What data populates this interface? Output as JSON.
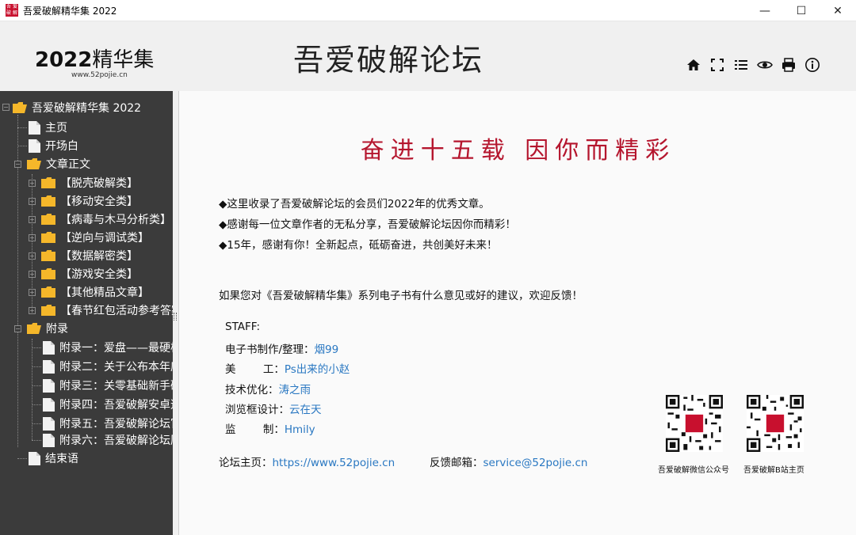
{
  "window": {
    "title": "吾爱破解精华集 2022",
    "app_icon_text": [
      "吾",
      "爱",
      "破",
      "解"
    ],
    "minimize": "—",
    "maximize": "☐",
    "close": "✕"
  },
  "header": {
    "logo_year": "2022",
    "logo_text": "精华集",
    "logo_url": "www.52pojie.cn",
    "site_title": "吾爱破解论坛"
  },
  "toolbar": {
    "buttons": [
      "home-icon",
      "fullscreen-icon",
      "list-icon",
      "eye-icon",
      "print-icon",
      "info-icon"
    ]
  },
  "sidebar": {
    "root": "吾爱破解精华集 2022",
    "home": "主页",
    "intro": "开场白",
    "articles": "文章正文",
    "article_categories": [
      "【脱壳破解类】",
      "【移动安全类】",
      "【病毒与木马分析类】",
      "【逆向与调试类】",
      "【数据解密类】",
      "【游戏安全类】",
      "【其他精品文章】",
      "【春节红包活动参考答案】"
    ],
    "appendix": "附录",
    "appendix_items": [
      "附录一：爱盘——最硬核",
      "附录二：关于公布本年度",
      "附录三：关零基础新手研",
      "附录四：吾爱破解安卓逆",
      "附录五：吾爱破解论坛官",
      "附录六：吾爱破解论坛历"
    ],
    "closing": "结束语"
  },
  "content": {
    "headline": "奋进十五载  因你而精彩",
    "bullets": [
      "◆这里收录了吾爱破解论坛的会员们2022年的优秀文章。",
      "◆感谢每一位文章作者的无私分享，吾爱破解论坛因你而精彩！",
      "◆15年，感谢有你！全新起点，砥砺奋进，共创美好未来！"
    ],
    "feedback_text": "如果您对《吾爱破解精华集》系列电子书有什么意见或好的建议，欢迎反馈！",
    "staff_heading": "STAFF:",
    "staff": [
      {
        "role": "电子书制作/整理：",
        "name": "烟99"
      },
      {
        "role": "美        工：",
        "name": "Ps出来的小赵"
      },
      {
        "role": "技术优化：",
        "name": "涛之雨"
      },
      {
        "role": "浏览框设计：",
        "name": "云在天"
      },
      {
        "role": "监        制：",
        "name": "Hmily"
      }
    ],
    "forum_label": "论坛主页：",
    "forum_url": "https://www.52pojie.cn",
    "email_label": "反馈邮箱：",
    "email": "service@52pojie.cn",
    "qr_codes": [
      {
        "caption": "吾爱破解微信公众号",
        "badge": "吾爱破解"
      },
      {
        "caption": "吾爱破解B站主页",
        "badge": "吾爱破解"
      }
    ]
  },
  "colors": {
    "accent_red": "#b5162e",
    "link_blue": "#2a78c2",
    "sidebar_bg": "#3b3b3b",
    "folder_yellow": "#f5b72a"
  }
}
